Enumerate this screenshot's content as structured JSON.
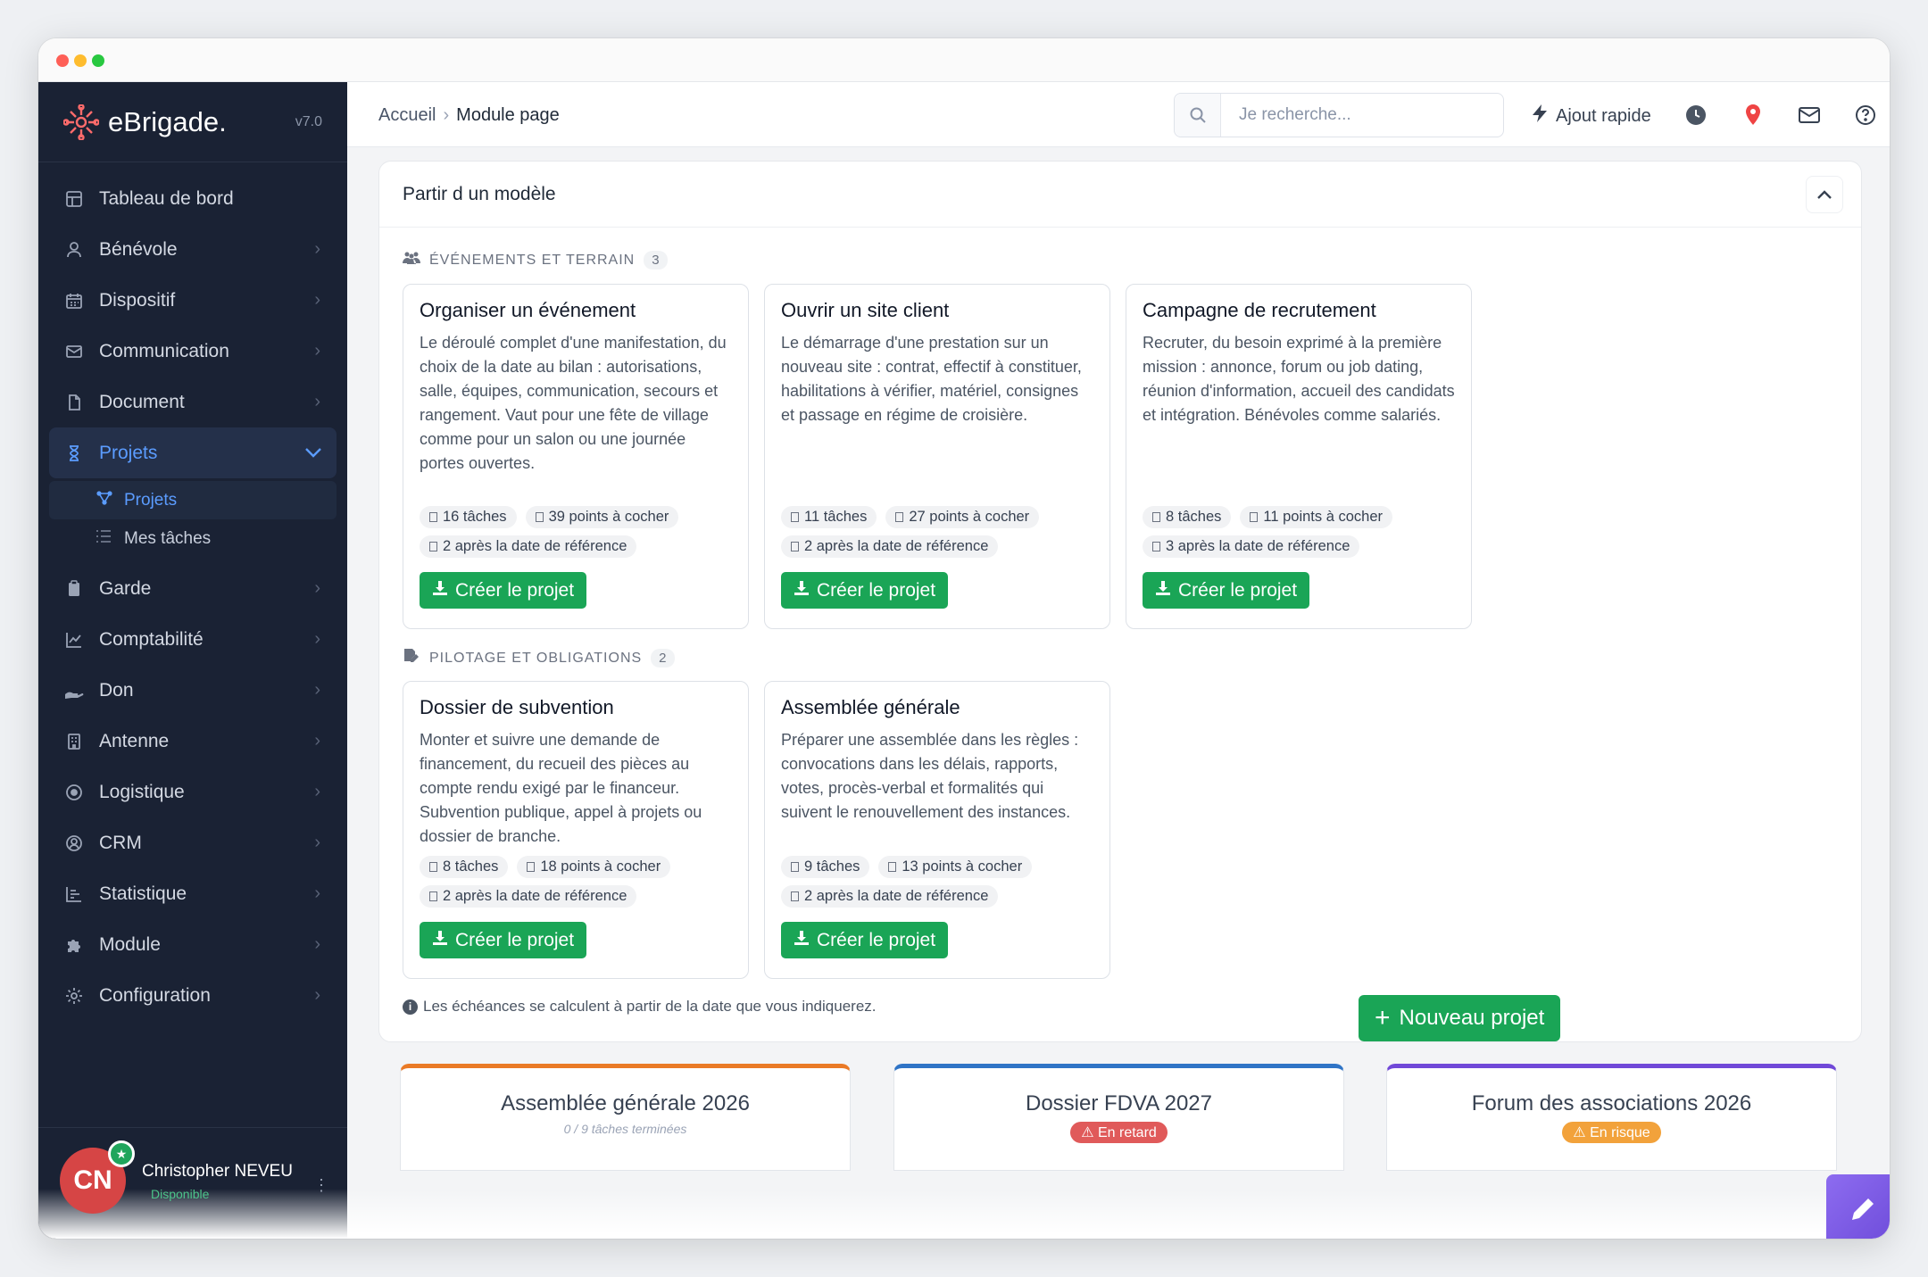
{
  "brand": {
    "name": "eBrigade.",
    "version": "v7.0"
  },
  "sidebar": {
    "items": [
      {
        "label": "Tableau de bord",
        "icon": "dashboard-icon",
        "chevron": false
      },
      {
        "label": "Bénévole",
        "icon": "user-icon",
        "chevron": true
      },
      {
        "label": "Dispositif",
        "icon": "calendar-icon",
        "chevron": true
      },
      {
        "label": "Communication",
        "icon": "mail-icon",
        "chevron": true
      },
      {
        "label": "Document",
        "icon": "document-icon",
        "chevron": true
      },
      {
        "label": "Projets",
        "icon": "hourglass-icon",
        "chevron": true,
        "open": true
      },
      {
        "label": "Garde",
        "icon": "clipboard-icon",
        "chevron": true
      },
      {
        "label": "Comptabilité",
        "icon": "chart-line-icon",
        "chevron": true
      },
      {
        "label": "Don",
        "icon": "hand-icon",
        "chevron": true
      },
      {
        "label": "Antenne",
        "icon": "building-icon",
        "chevron": true
      },
      {
        "label": "Logistique",
        "icon": "target-icon",
        "chevron": true
      },
      {
        "label": "CRM",
        "icon": "user-circle-icon",
        "chevron": true
      },
      {
        "label": "Statistique",
        "icon": "bar-list-icon",
        "chevron": true
      },
      {
        "label": "Module",
        "icon": "puzzle-icon",
        "chevron": true
      },
      {
        "label": "Configuration",
        "icon": "gear-icon",
        "chevron": true
      }
    ],
    "subitems": [
      {
        "label": "Projets",
        "icon": "project-tree-icon",
        "active": true
      },
      {
        "label": "Mes tâches",
        "icon": "task-list-icon",
        "active": false
      }
    ]
  },
  "user": {
    "initials": "CN",
    "name": "Christopher NEVEU",
    "status": "Disponible"
  },
  "topbar": {
    "breadcrumb_home": "Accueil",
    "breadcrumb_current": "Module page",
    "search_placeholder": "Je recherche...",
    "quick_add": "Ajout rapide"
  },
  "panel": {
    "title": "Partir d un modèle",
    "section1": {
      "label": "ÉVÉNEMENTS ET TERRAIN",
      "count": "3"
    },
    "section2": {
      "label": "PILOTAGE ET OBLIGATIONS",
      "count": "2"
    },
    "create_label": "Créer le projet",
    "cards": [
      {
        "title": "Organiser un événement",
        "desc": "Le déroulé complet d'une manifestation, du choix de la date au bilan : autorisations, salle, équipes, communication, secours et rangement. Vaut pour une fête de village comme pour un salon ou une journée portes ouvertes.",
        "tasks": "16 tâches",
        "points": "39 points à cocher",
        "after": "2 après la date de référence"
      },
      {
        "title": "Ouvrir un site client",
        "desc": "Le démarrage d'une prestation sur un nouveau site : contrat, effectif à constituer, habilitations à vérifier, matériel, consignes et passage en régime de croisière.",
        "tasks": "11 tâches",
        "points": "27 points à cocher",
        "after": "2 après la date de référence"
      },
      {
        "title": "Campagne de recrutement",
        "desc": "Recruter, du besoin exprimé à la première mission : annonce, forum ou job dating, réunion d'information, accueil des candidats et intégration. Bénévoles comme salariés.",
        "tasks": "8 tâches",
        "points": "11 points à cocher",
        "after": "3 après la date de référence"
      },
      {
        "title": "Dossier de subvention",
        "desc": "Monter et suivre une demande de financement, du recueil des pièces au compte rendu exigé par le financeur. Subvention publique, appel à projets ou dossier de branche.",
        "tasks": "8 tâches",
        "points": "18 points à cocher",
        "after": "2 après la date de référence"
      },
      {
        "title": "Assemblée générale",
        "desc": "Préparer une assemblée dans les règles : convocations dans les délais, rapports, votes, procès-verbal et formalités qui suivent le renouvellement des instances.",
        "tasks": "9 tâches",
        "points": "13 points à cocher",
        "after": "2 après la date de référence"
      }
    ],
    "note": "Les échéances se calculent à partir de la date que vous indiquerez."
  },
  "new_project": "Nouveau projet",
  "projects": [
    {
      "title": "Assemblée générale 2026",
      "sub": "0 / 9 tâches terminées",
      "color": "#ea7a26"
    },
    {
      "title": "Dossier FDVA 2027",
      "badge": "En retard",
      "color": "#2f74c6",
      "badge_color": "#e05a5a"
    },
    {
      "title": "Forum des associations 2026",
      "badge": "En risque",
      "color": "#7048d8",
      "badge_color": "#f2a23b"
    }
  ]
}
